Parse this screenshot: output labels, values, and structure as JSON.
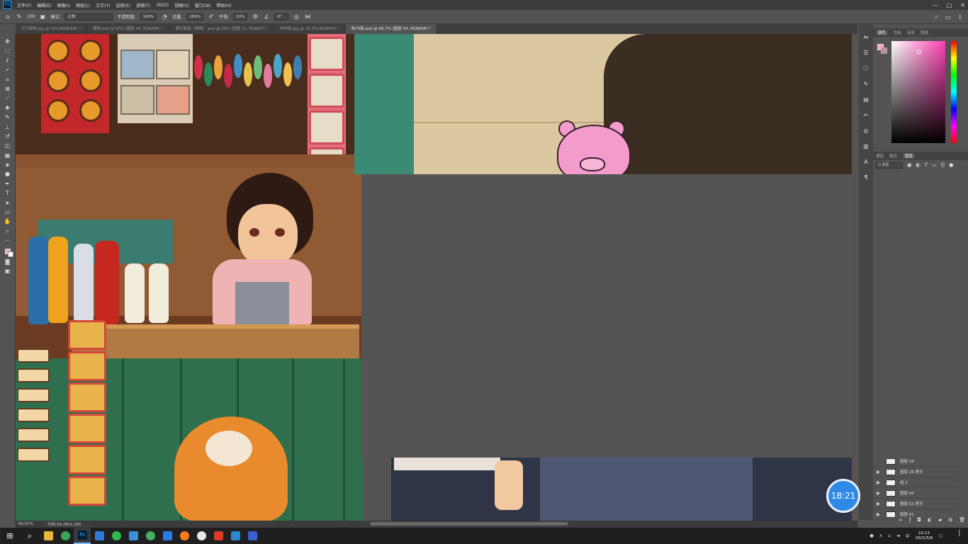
{
  "app": {
    "logo": "Ps"
  },
  "menu": [
    "文件(F)",
    "编辑(E)",
    "图像(I)",
    "图层(L)",
    "文字(Y)",
    "选择(S)",
    "滤镜(T)",
    "3D(D)",
    "视图(V)",
    "窗口(W)",
    "帮助(H)"
  ],
  "window_controls": {
    "minimize": "—",
    "maximize": "□",
    "close": "✕"
  },
  "options": {
    "mode_label": "模式:",
    "mode_value": "正常",
    "opacity_label": "不透明度:",
    "opacity_value": "100%",
    "flow_label": "流量:",
    "flow_value": "100%",
    "smooth_label": "平滑:",
    "smooth_value": "10%",
    "angle_value": "0°",
    "brush_size": "100"
  },
  "tabs": [
    "元气森林.jpg @ 50%(RGB/8#) *",
    "喵林.psd @ 50% (图层 44, RGB/8#) *",
    "梦幻新街（明明）.psd @ 50% (图层 21, RGB/8*) *",
    "咔咔街.jpg @ 33.2%(RGB/8#) *",
    "味70新.psd @ 66.7% (图层 54, RGB/8#) *"
  ],
  "status": {
    "zoom": "66.67%",
    "doc": "文档:58.2M/1.29G"
  },
  "color_panel": {
    "tabs": [
      "颜色",
      "色板",
      "渐变",
      "图案"
    ],
    "fg_color": "#f3a6c8",
    "bg_color": "#c08aa8"
  },
  "layers_panel": {
    "tabs": [
      "通道",
      "路径",
      "图层"
    ],
    "filter_label": "Q 类型",
    "layers": [
      {
        "name": "图层 56"
      },
      {
        "name": "图层 26 拷贝"
      },
      {
        "name": "组 2"
      },
      {
        "name": "图层 60"
      },
      {
        "name": "图层 62 拷贝"
      },
      {
        "name": "图层 61"
      }
    ]
  },
  "timer": "18:21",
  "taskbar": {
    "start_glyph": "⊞",
    "search_glyph": "⌕",
    "apps": [
      "file-explorer",
      "browser",
      "photoshop",
      "media",
      "wechat",
      "folder",
      "app-green",
      "app-blue",
      "firefox",
      "app-circle",
      "wps",
      "app-blue2",
      "powerpoint"
    ],
    "time": "22:13",
    "date": "2021/5/6"
  }
}
